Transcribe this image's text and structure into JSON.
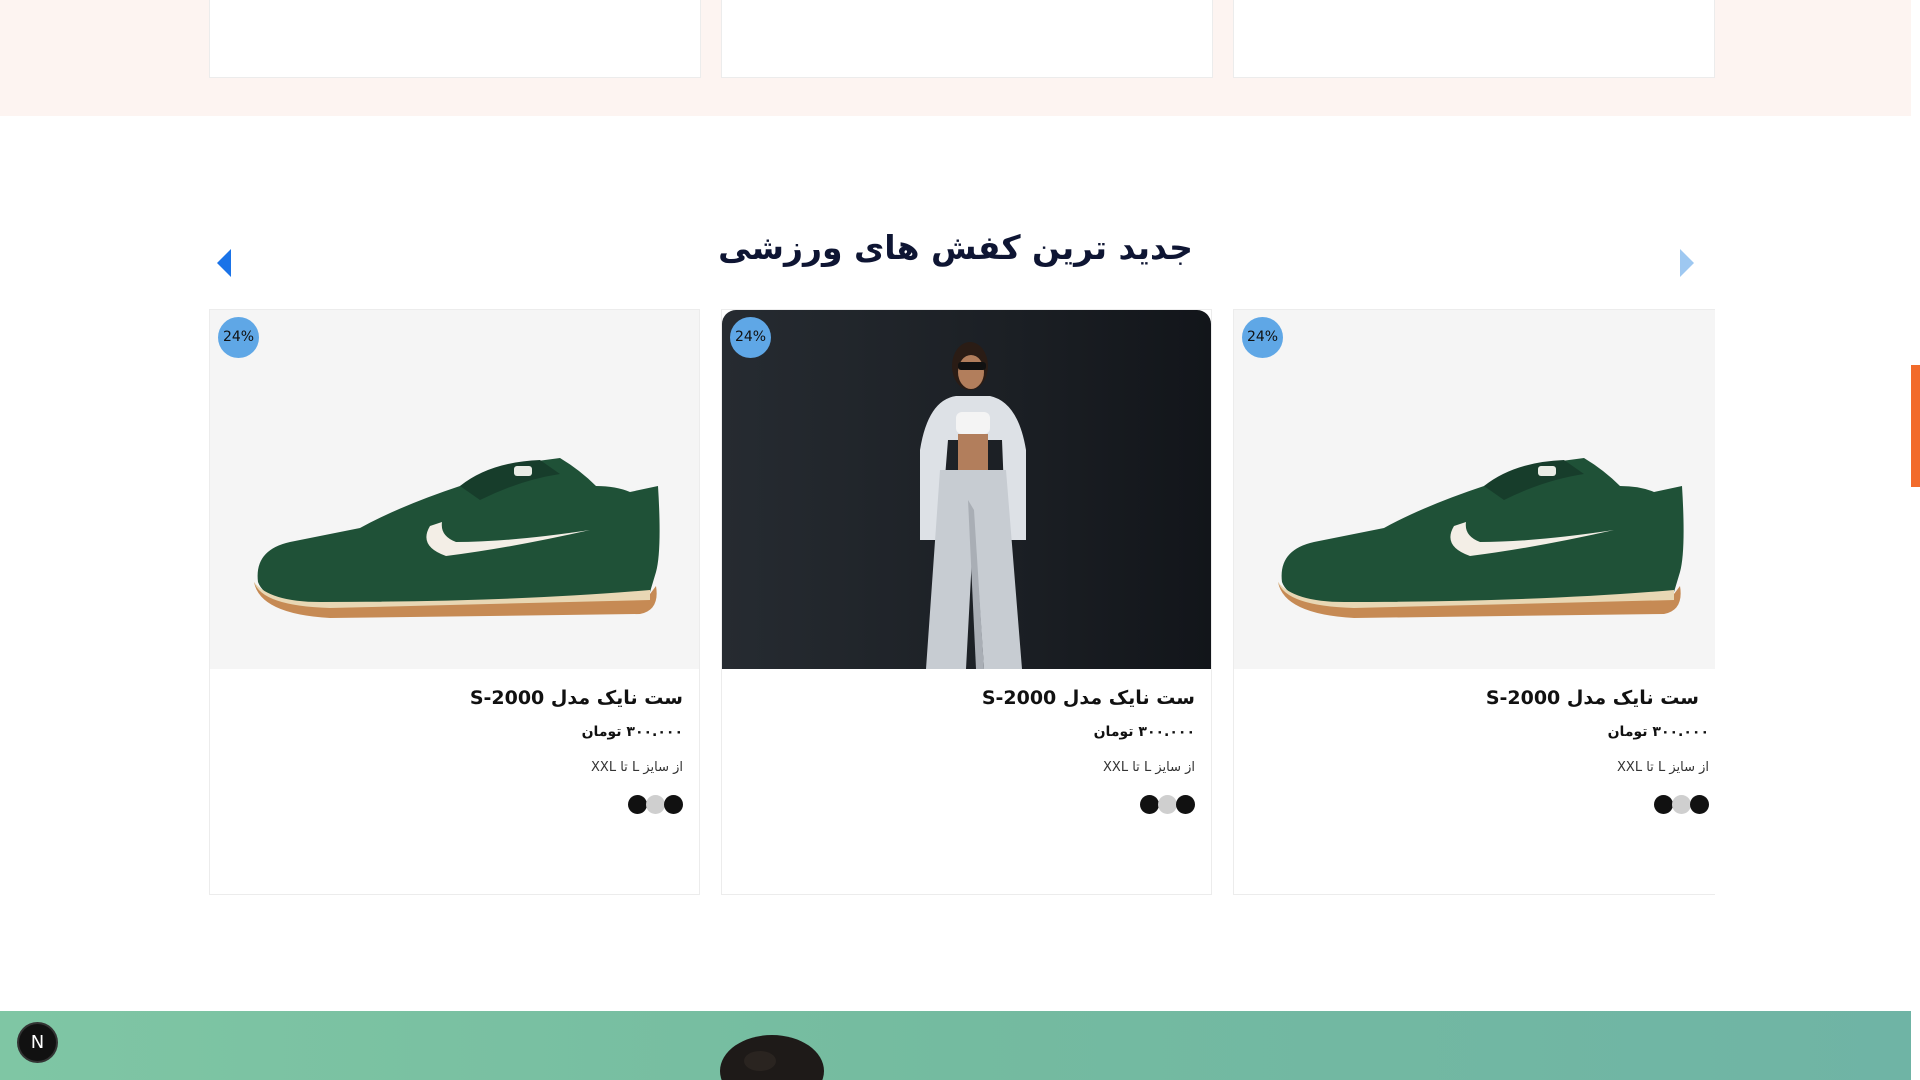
{
  "section": {
    "title": "جدید ترین کفش های ورزشی",
    "prev_icon": "caret-left-icon",
    "next_icon": "caret-right-icon"
  },
  "products": [
    {
      "discount": "24%",
      "name": "ست نایک مدل S-2000",
      "price": "۳۰۰.۰۰۰ تومان",
      "sizes": "از سایز L تا XXL",
      "image": "green-sneaker",
      "colors": [
        "#111111",
        "#cfcfcf",
        "#111111"
      ]
    },
    {
      "discount": "24%",
      "name": "ست نایک مدل S-2000",
      "price": "۳۰۰.۰۰۰ تومان",
      "sizes": "از سایز L تا XXL",
      "image": "woman-grey-sweatsuit",
      "colors": [
        "#111111",
        "#cfcfcf",
        "#111111"
      ]
    },
    {
      "discount": "24%",
      "name": "ست نایک مدل S-2000",
      "price": "۳۰۰.۰۰۰ تومان",
      "sizes": "از سایز L تا XXL",
      "image": "green-sneaker",
      "colors": [
        "#111111",
        "#cfcfcf",
        "#111111"
      ]
    }
  ],
  "dev_badge": {
    "label": "N"
  },
  "colors": {
    "accent_blue": "#1a73e8",
    "badge_blue": "#5fa7e6",
    "scroll_accent": "#f26b2b",
    "peach_band": "#fdf4f1",
    "teal_banner": "#74bba0"
  }
}
